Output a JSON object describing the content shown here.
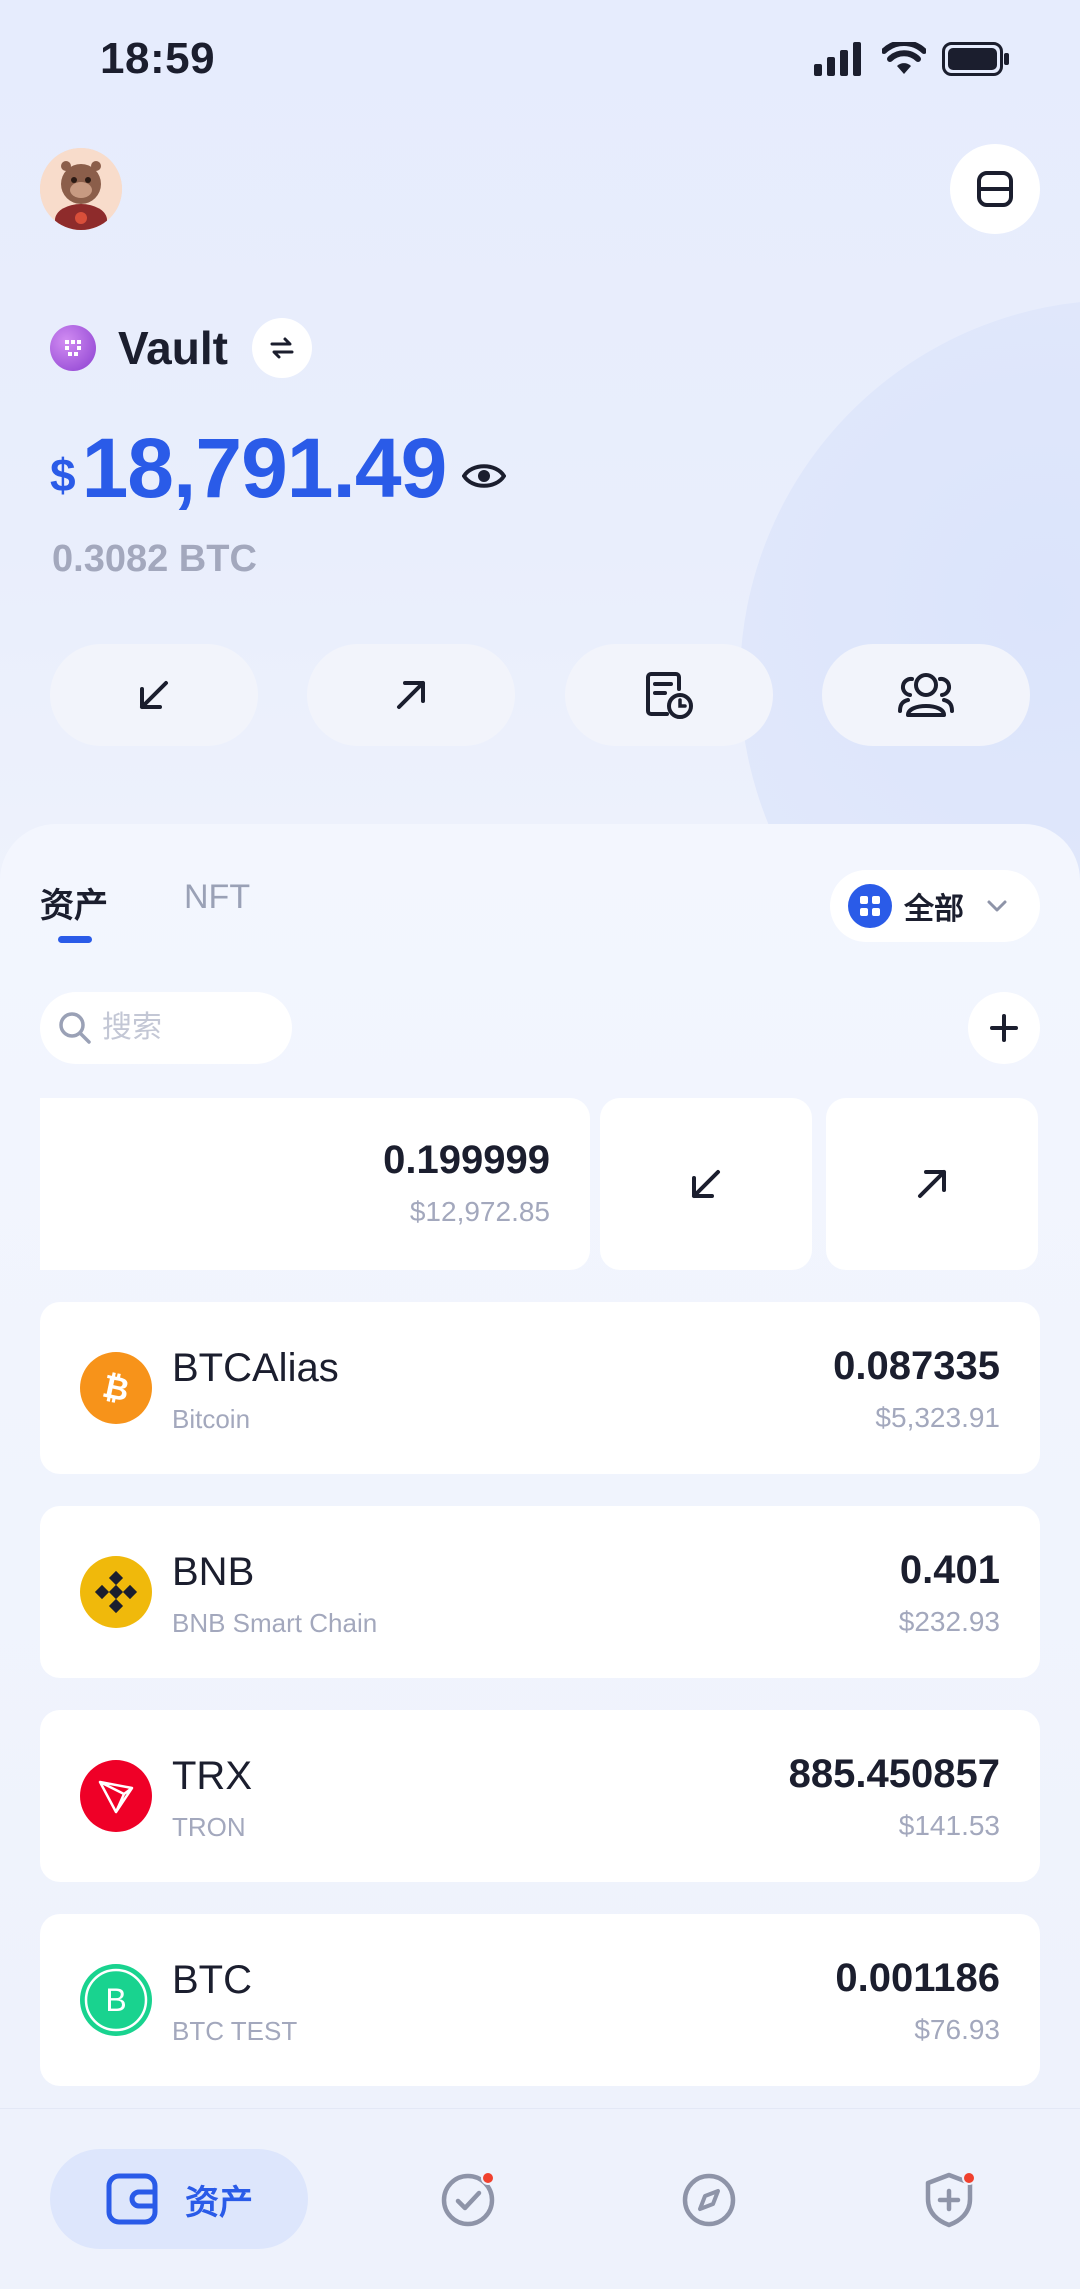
{
  "status_bar": {
    "time": "18:59"
  },
  "wallet": {
    "name": "Vault",
    "balance_currency": "$",
    "balance_value": "18,791.49",
    "balance_btc": "0.3082 BTC"
  },
  "actions": [
    {
      "icon": "receive-arrow-icon"
    },
    {
      "icon": "send-arrow-icon"
    },
    {
      "icon": "history-icon"
    },
    {
      "icon": "contacts-icon"
    }
  ],
  "tabs": [
    {
      "label": "资产",
      "active": true
    },
    {
      "label": "NFT",
      "active": false
    }
  ],
  "filter": {
    "label": "全部"
  },
  "search": {
    "placeholder": "搜索"
  },
  "swiped_row": {
    "amount": "0.199999",
    "fiat": "$12,972.85"
  },
  "assets": [
    {
      "symbol": "BTCAlias",
      "chain": "Bitcoin",
      "amount": "0.087335",
      "fiat": "$5,323.91",
      "logo": "bitcoin-logo-icon",
      "color": "#f7931a"
    },
    {
      "symbol": "BNB",
      "chain": "BNB Smart Chain",
      "amount": "0.401",
      "fiat": "$232.93",
      "logo": "bnb-logo-icon",
      "color": "#f0b90b"
    },
    {
      "symbol": "TRX",
      "chain": "TRON",
      "amount": "885.450857",
      "fiat": "$141.53",
      "logo": "tron-logo-icon",
      "color": "#ef0027"
    },
    {
      "symbol": "BTC",
      "chain": "BTC TEST",
      "amount": "0.001186",
      "fiat": "$76.93",
      "logo": "btc-test-logo-icon",
      "color": "#19d38f",
      "logo_letter": "B"
    }
  ],
  "bottom_nav": {
    "active_label": "资产",
    "items": [
      {
        "icon": "wallet-icon",
        "active": true
      },
      {
        "icon": "check-circle-icon",
        "badge": true
      },
      {
        "icon": "compass-icon",
        "badge": false
      },
      {
        "icon": "shield-plus-icon",
        "badge": true
      }
    ]
  },
  "colors": {
    "accent": "#2a5be8",
    "badge": "#f0412e",
    "muted_text": "#a3a8bd"
  }
}
